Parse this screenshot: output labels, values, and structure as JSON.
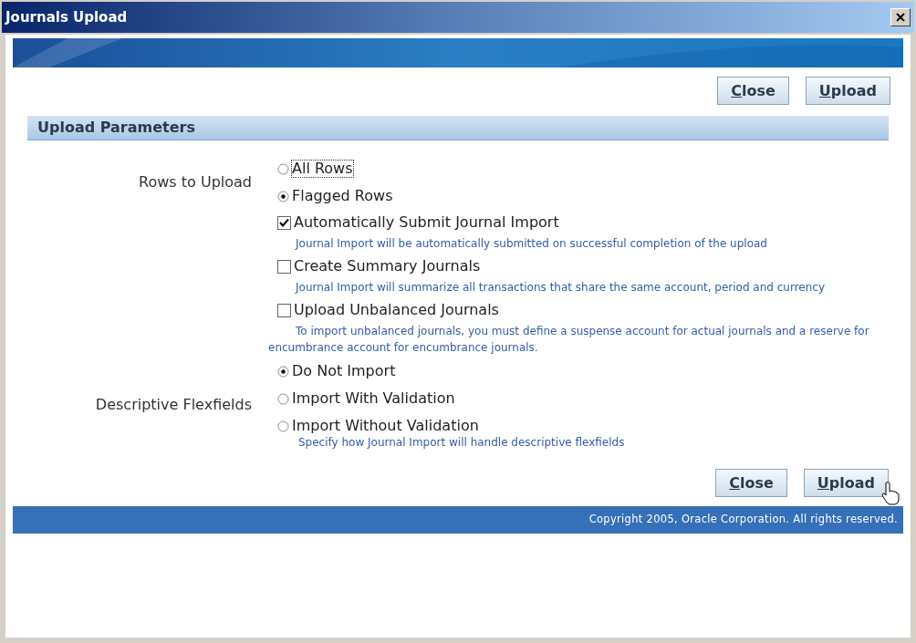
{
  "window": {
    "title": "Journals Upload"
  },
  "top_buttons": [
    {
      "label": "Close"
    },
    {
      "label": "Upload"
    }
  ],
  "section": {
    "title": "Upload Parameters"
  },
  "fields": [
    {
      "kind": "radio_group",
      "label": "Rows to Upload",
      "options": [
        {
          "label": "All Rows",
          "selected": false,
          "focused": true
        },
        {
          "label": "Flagged Rows",
          "selected": true,
          "focused": false
        }
      ]
    },
    {
      "kind": "checkbox",
      "label": "Automatically Submit Journal Import",
      "checked": true,
      "note": "Journal Import will be automatically submitted on successful completion of the upload"
    },
    {
      "kind": "checkbox",
      "label": "Create Summary Journals",
      "checked": false,
      "note": "Journal Import will summarize all transactions that share the same account, period and currency"
    },
    {
      "kind": "checkbox",
      "label": "Upload Unbalanced Journals",
      "checked": false,
      "note": "To import unbalanced journals, you must define a suspense account for actual journals and a reserve for encumbrance account for encumbrance journals."
    },
    {
      "kind": "radio_group",
      "label": "Descriptive Flexfields",
      "options": [
        {
          "label": "Do Not Import",
          "selected": true,
          "focused": false
        },
        {
          "label": "Import With Validation",
          "selected": false,
          "focused": false
        },
        {
          "label": "Import Without Validation",
          "selected": false,
          "focused": false
        }
      ],
      "note": "Specify how Journal Import will handle descriptive flexfields"
    }
  ],
  "bottom_buttons": [
    {
      "label": "Close"
    },
    {
      "label": "Upload"
    }
  ],
  "footer": {
    "copyright": "Copyright 2005, Oracle Corporation. All rights reserved."
  }
}
